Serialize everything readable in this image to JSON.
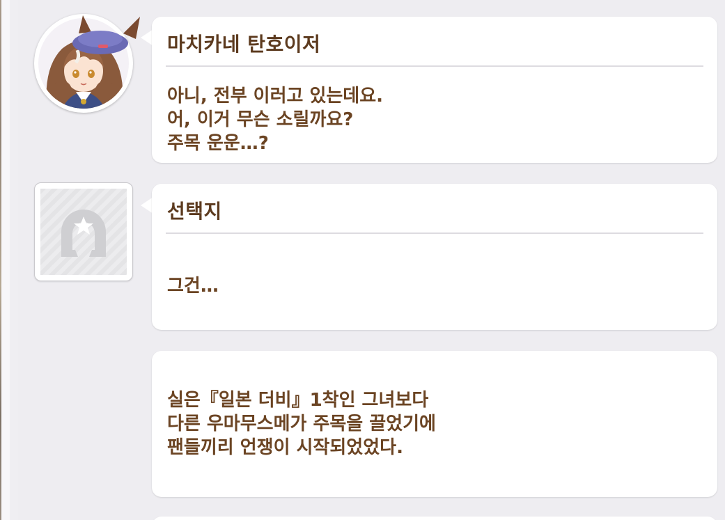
{
  "messages": [
    {
      "speaker": "마치카네 탄호이저",
      "lines": "아니, 전부 이러고 있는데요.\n어, 이거 무슨 소릴까요?\n주목 운운…?",
      "avatar": "character-portrait"
    },
    {
      "speaker": "선택지",
      "lines": "그건…",
      "avatar": "horseshoe-placeholder-icon"
    },
    {
      "lines": "실은『일본 더비』1착인 그녀보다\n다른 우마무스메가 주목을 끌었기에\n팬들끼리 언쟁이 시작되었었다."
    }
  ],
  "colors": {
    "background": "#eeedf1",
    "bubble": "#ffffff",
    "name_text": "#5c3a1e",
    "body_text": "#6b4423",
    "divider": "#dddbe0"
  }
}
